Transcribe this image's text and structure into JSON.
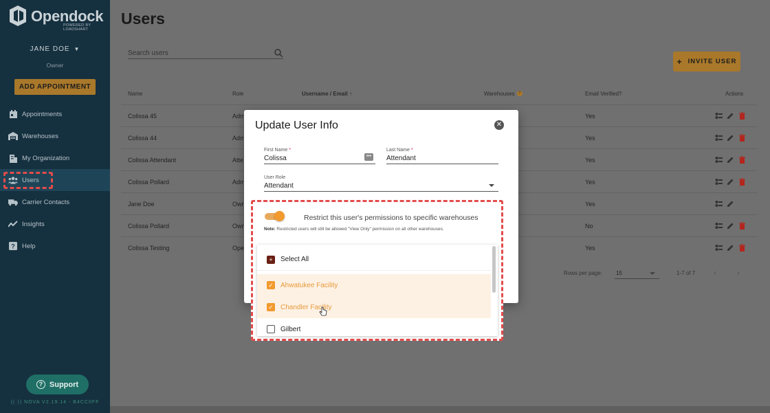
{
  "brand": {
    "name": "Opendock",
    "sub": "POWERED BY LOADSHART"
  },
  "user": {
    "name": "JANE DOE",
    "role": "Owner"
  },
  "sidebar": {
    "add_appointment": "ADD APPOINTMENT",
    "items": [
      {
        "label": "Appointments",
        "icon": "calendar-icon"
      },
      {
        "label": "Warehouses",
        "icon": "warehouse-icon"
      },
      {
        "label": "My Organization",
        "icon": "building-icon"
      },
      {
        "label": "Users",
        "icon": "users-icon",
        "active": true
      },
      {
        "label": "Carrier Contacts",
        "icon": "truck-icon"
      },
      {
        "label": "Insights",
        "icon": "chart-icon"
      },
      {
        "label": "Help",
        "icon": "help-icon"
      }
    ],
    "support": "Support",
    "version": "NOVA V2.19.14 - B4CC0FF"
  },
  "page": {
    "title": "Users",
    "search_placeholder": "Search users",
    "invite": "INVITE USER"
  },
  "table": {
    "headers": {
      "name": "Name",
      "role": "Role",
      "username": "Username / Email",
      "warehouses": "Warehouses",
      "verified": "Email Verified?",
      "actions": "Actions"
    },
    "rows": [
      {
        "name": "Colissa 45",
        "role": "Adm",
        "verified": "Yes",
        "delete": true
      },
      {
        "name": "Colissa 44",
        "role": "Adm",
        "verified": "Yes",
        "delete": true
      },
      {
        "name": "Colissa Attendant",
        "role": "Atte",
        "verified": "Yes",
        "delete": true
      },
      {
        "name": "Colissa Pollard",
        "role": "Adm",
        "verified": "Yes",
        "delete": true
      },
      {
        "name": "Jane Doe",
        "role": "Own",
        "verified": "Yes",
        "delete": false
      },
      {
        "name": "Colissa Pollard",
        "role": "Own",
        "verified": "No",
        "delete": true
      },
      {
        "name": "Colissa Testing",
        "role": "Ope",
        "verified": "Yes",
        "delete": true
      }
    ],
    "rows_per_page_label": "Rows per page:",
    "rows_per_page": "15",
    "count": "1-7 of 7"
  },
  "modal": {
    "title": "Update User Info",
    "first_name_label": "First Name",
    "first_name": "Colissa",
    "last_name_label": "Last Name",
    "last_name": "Attendant",
    "role_label": "User Role",
    "role": "Attendant",
    "restrict_label": "Restrict this user's permissions to specific warehouses",
    "note_prefix": "Note:",
    "note": "Restricted users will still be allowed \"View Only\" permission on all other warehouses.",
    "select_all": "Select All",
    "warehouses": [
      {
        "label": "Ahwatukee Facility",
        "checked": true
      },
      {
        "label": "Chandler Facility",
        "checked": true
      },
      {
        "label": "Gilbert",
        "checked": false
      }
    ]
  },
  "colors": {
    "accent": "#f29a2e",
    "sidebar": "#15303f",
    "highlight": "#e34b4b",
    "support": "#1f6f66"
  }
}
